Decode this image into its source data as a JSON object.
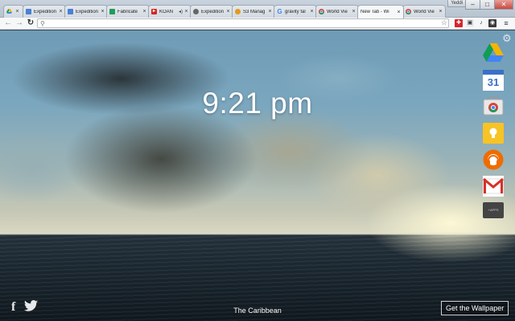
{
  "browser": {
    "user_name": "Yeddi",
    "window_buttons": {
      "minimize": "–",
      "maximize": "□",
      "close": "✕"
    },
    "tabs": [
      {
        "title": "",
        "icon": "google-drive-icon",
        "color": "#3b9d4f",
        "active": false
      },
      {
        "title": "Expedition",
        "icon": "google-docs-icon",
        "color": "#4a7fd4",
        "active": false
      },
      {
        "title": "Expedition",
        "icon": "google-docs-icon",
        "color": "#4a7fd4",
        "active": false
      },
      {
        "title": "Fabricate",
        "icon": "google-sheets-icon",
        "color": "#1f9d55",
        "active": false
      },
      {
        "title": "KOAN",
        "icon": "youtube-icon",
        "color": "#d8261f",
        "active": false,
        "audio": "◂)"
      },
      {
        "title": "Expedition",
        "icon": "generic-site-icon",
        "color": "#666666",
        "active": false
      },
      {
        "title": "S3 Manag",
        "icon": "aws-icon",
        "color": "#e39a1b",
        "active": false
      },
      {
        "title": "gravity fal",
        "icon": "google-search-icon",
        "color": "#4285f4",
        "active": false
      },
      {
        "title": "World Vie",
        "icon": "chrome-icon",
        "color": "#d6453a",
        "active": false
      },
      {
        "title": "New Tab - Wi",
        "icon": "",
        "color": "",
        "active": true
      },
      {
        "title": "World Vie",
        "icon": "chrome-icon",
        "color": "#d6453a",
        "active": false
      }
    ],
    "tab_close_glyph": "×",
    "omnibox": {
      "value": "",
      "placeholder": ""
    }
  },
  "page": {
    "clock": "9:21 pm",
    "location": "The Caribbean",
    "wallpaper_button": "Get the Wallpaper",
    "apps": [
      {
        "name": "Google Drive",
        "icon": "google-drive-icon"
      },
      {
        "name": "Google Calendar",
        "icon": "google-calendar-icon",
        "label": "31"
      },
      {
        "name": "Chrome Web Store",
        "icon": "chrome-web-store-icon"
      },
      {
        "name": "Google Keep",
        "icon": "google-keep-icon"
      },
      {
        "name": "Google Play Music",
        "icon": "play-music-icon"
      },
      {
        "name": "Gmail",
        "icon": "gmail-icon"
      },
      {
        "name": "Apps Launcher",
        "icon": "app-launcher-icon",
        "label": "+APPS"
      }
    ],
    "social": {
      "facebook": "f",
      "twitter": "twitter-icon"
    }
  }
}
